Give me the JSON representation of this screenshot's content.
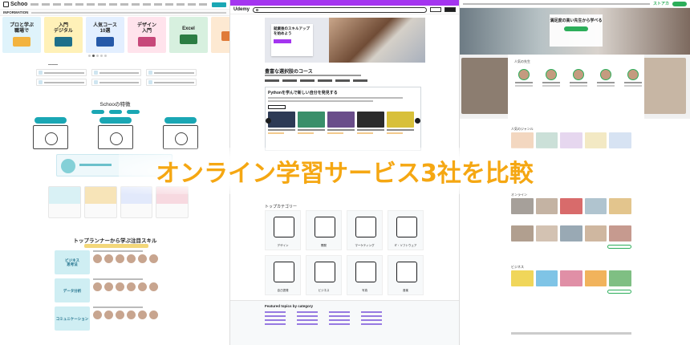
{
  "title": "オンライン学習サービス3社を比較",
  "left_site": {
    "logo": "Schoo",
    "info_label": "INFORMATION",
    "banners": [
      {
        "text": "プロと学ぶ\n職場で",
        "bg": "#dff3fb",
        "accent": "#f3b33f"
      },
      {
        "text": "入門\nデジタル",
        "bg": "#fff1b8",
        "accent": "#1e6f8a"
      },
      {
        "text": "人気コース\n10選",
        "bg": "#e3efff",
        "accent": "#2659a8"
      },
      {
        "text": "デザイン\n入門",
        "bg": "#ffe3ec",
        "accent": "#c7487a"
      },
      {
        "text": "Excel",
        "bg": "#d7f0df",
        "accent": "#2b7d43"
      },
      {
        "text": "",
        "bg": "#fde9d2",
        "accent": "#e07b39"
      }
    ],
    "map_title": "Schooの特徴",
    "map_items": [
      "",
      "",
      ""
    ],
    "top_title": "トップランナーから学ぶ注目スキル",
    "rows": [
      {
        "thumb": "ビジネス\n思考法"
      },
      {
        "thumb": "データ分析"
      },
      {
        "thumb": "コミュニケーション"
      }
    ]
  },
  "middle_site": {
    "logo": "Udemy",
    "hero_text": "就業後のスキルアップを始めよう",
    "section_title": "豊富な選択肢のコース",
    "box_title": "Pythonを学んで新しい自分を発見する",
    "categories_title": "トップカテゴリー",
    "categories": [
      "デザイン",
      "開発",
      "マーケティング",
      "IT・ソフトウェア",
      "自己啓発",
      "ビジネス",
      "写真",
      "音楽"
    ],
    "footer_title": "Featured topics by category",
    "course_colors": [
      "#2d3a55",
      "#3a8f6a",
      "#6a4d8a",
      "#2b2b2b",
      "#d8c03a"
    ]
  },
  "right_site": {
    "logo": "ストアカ",
    "hero_text": "満足度の高い先生から学べる",
    "pros_title": "人気の先生",
    "sections": [
      "人気のジャンル",
      "オンライン",
      "ビジネス"
    ]
  }
}
